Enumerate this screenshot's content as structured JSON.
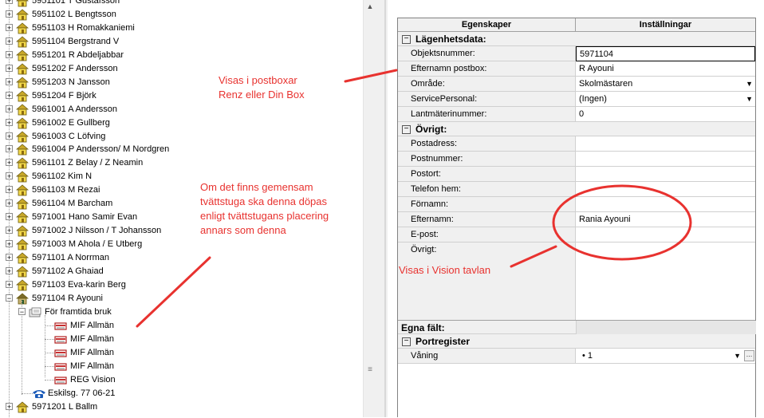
{
  "tree": {
    "items": [
      {
        "label": "5951101 T Gustafsson"
      },
      {
        "label": "5951102 L Bengtsson"
      },
      {
        "label": "5951103 H Romakkaniemi"
      },
      {
        "label": "5951104 Bergstrand V"
      },
      {
        "label": "5951201 R Abdeljabbar"
      },
      {
        "label": "5951202 F Andersson"
      },
      {
        "label": "5951203 N Jansson"
      },
      {
        "label": "5951204 F Björk"
      },
      {
        "label": "5961001 A Andersson"
      },
      {
        "label": "5961002 E Gullberg"
      },
      {
        "label": "5961003 C Löfving"
      },
      {
        "label": "5961004 P Andersson/ M Nordgren"
      },
      {
        "label": "5961101 Z Belay / Z  Neamin"
      },
      {
        "label": "5961102 Kim N"
      },
      {
        "label": "5961103 M Rezai"
      },
      {
        "label": "5961104 M Barcham"
      },
      {
        "label": "5971001 Hano Samir Evan"
      },
      {
        "label": "5971002 J Nilsson / T Johansson"
      },
      {
        "label": "5971003 M Ahola / E Utberg"
      },
      {
        "label": "5971101 A Norrman"
      },
      {
        "label": "5971102 A Ghaiad"
      },
      {
        "label": "5971103 Eva-karin Berg"
      },
      {
        "label": "5971104 R Ayouni"
      }
    ],
    "sub_folder": "För framtida bruk",
    "sub_items": [
      "MIF Allmän",
      "MIF Allmän",
      "MIF Allmän",
      "MIF Allmän",
      "REG Vision"
    ],
    "phone_item": "Eskilsg. 77 06-21",
    "last_partial": "5971201 L Ballm"
  },
  "grid": {
    "header_properties": "Egenskaper",
    "header_settings": "Inställningar",
    "cat_apartment": "Lägenhetsdata:",
    "cat_other": "Övrigt:",
    "cat_custom": "Egna fält:",
    "cat_portreg": "Portregister",
    "rows": {
      "objektsnummer": {
        "name": "Objektsnummer:",
        "value": "5971104"
      },
      "efternamn_postbox": {
        "name": "Efternamn postbox:",
        "value": "R Ayouni"
      },
      "omrade": {
        "name": "Område:",
        "value": "Skolmästaren"
      },
      "servicepersonal": {
        "name": "ServicePersonal:",
        "value": "(Ingen)"
      },
      "lantmaterinummer": {
        "name": "Lantmäterinummer:",
        "value": "0"
      },
      "postadress": {
        "name": "Postadress:",
        "value": ""
      },
      "postnummer": {
        "name": "Postnummer:",
        "value": ""
      },
      "postort": {
        "name": "Postort:",
        "value": ""
      },
      "telefon": {
        "name": "Telefon hem:",
        "value": ""
      },
      "fornamn": {
        "name": "Förnamn:",
        "value": ""
      },
      "efternamn": {
        "name": "Efternamn:",
        "value": "Rania Ayouni"
      },
      "epost": {
        "name": "E-post:",
        "value": ""
      },
      "ovrigt": {
        "name": "Övrigt:",
        "value": ""
      },
      "vaning": {
        "name": "Våning",
        "value": "• 1"
      }
    }
  },
  "annotations": {
    "postbox_line1": "Visas i postboxar",
    "postbox_line2": "Renz eller Din Box",
    "tvatt_line1": "Om det finns gemensam",
    "tvatt_line2": "tvättstuga ska denna döpas",
    "tvatt_line3": "enligt tvättstugans placering",
    "tvatt_line4": "annars som denna",
    "vision": "Visas i Vision tavlan",
    "color": "#e8322f"
  },
  "icons": {
    "house": "house-icon",
    "folder": "folder-icon",
    "card": "card-icon",
    "phone": "phone-icon"
  }
}
